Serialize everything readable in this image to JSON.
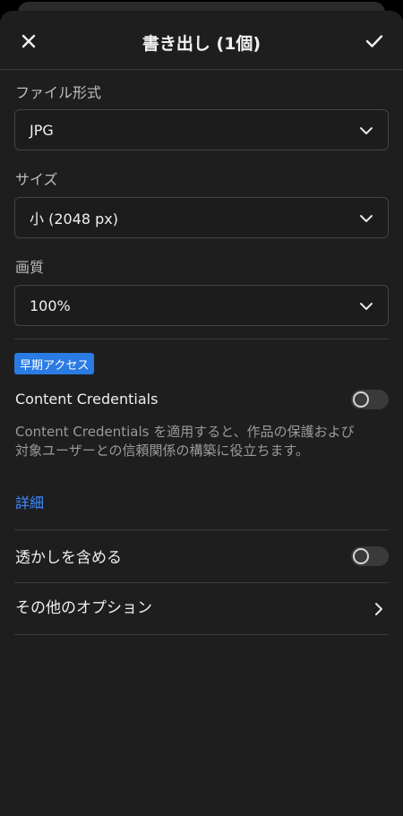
{
  "header": {
    "title": "書き出し (1個)",
    "close_icon": "close-icon",
    "confirm_icon": "checkmark-icon"
  },
  "file_format": {
    "label": "ファイル形式",
    "value": "JPG"
  },
  "size": {
    "label": "サイズ",
    "value": "小 (2048 px)"
  },
  "quality": {
    "label": "画質",
    "value": "100%"
  },
  "content_credentials": {
    "badge": "早期アクセス",
    "label": "Content Credentials",
    "enabled": false,
    "description": "Content Credentials を適用すると、作品の保護および対象ユーザーとの信頼関係の構築に役立ちます。",
    "details_link": "詳細"
  },
  "watermark": {
    "label": "透かしを含める",
    "enabled": false
  },
  "more_options": {
    "label": "その他のオプション"
  },
  "colors": {
    "background": "#1e1e1e",
    "accent_badge": "#2a7be4",
    "link": "#3d8bff"
  }
}
